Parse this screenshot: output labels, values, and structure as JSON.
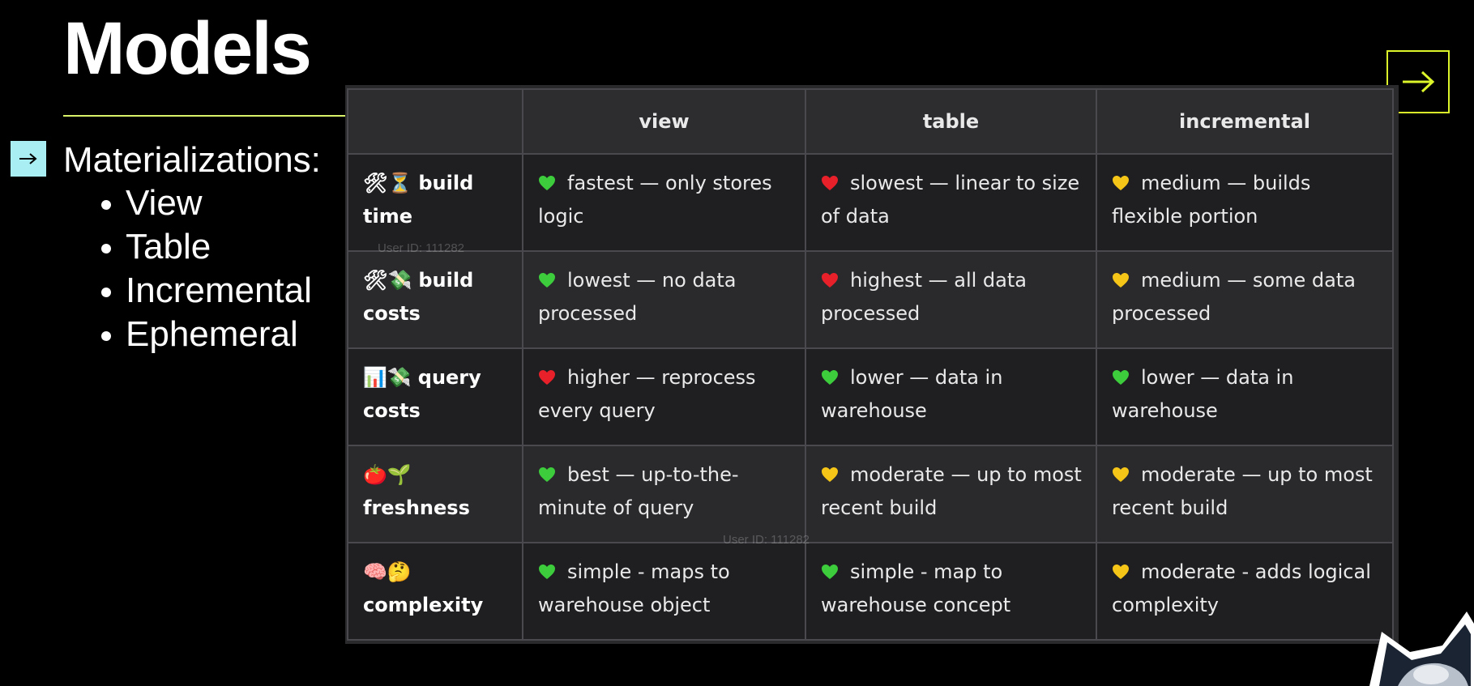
{
  "slide": {
    "title": "Models",
    "section_heading": "Materializations:",
    "bullets": [
      "View",
      "Table",
      "Incremental",
      "Ephemeral"
    ],
    "watermark_text": "User ID: 111282"
  },
  "table": {
    "columns": [
      "",
      "view",
      "table",
      "incremental"
    ],
    "rows": [
      {
        "label_emoji": "🛠⏳",
        "label": "build time",
        "cells": [
          {
            "rating": "green",
            "text": "fastest — only stores logic"
          },
          {
            "rating": "red",
            "text": "slowest — linear to size of data"
          },
          {
            "rating": "yellow",
            "text": "medium — builds flexible portion"
          }
        ]
      },
      {
        "label_emoji": "🛠💸",
        "label": "build costs",
        "cells": [
          {
            "rating": "green",
            "text": "lowest — no data processed"
          },
          {
            "rating": "red",
            "text": "highest — all data processed"
          },
          {
            "rating": "yellow",
            "text": "medium — some data processed"
          }
        ]
      },
      {
        "label_emoji": "📊💸",
        "label": "query costs",
        "cells": [
          {
            "rating": "red",
            "text": "higher — reprocess every query"
          },
          {
            "rating": "green",
            "text": "lower — data in warehouse"
          },
          {
            "rating": "green",
            "text": "lower — data in warehouse"
          }
        ]
      },
      {
        "label_emoji": "🍅🌱",
        "label": "freshness",
        "cells": [
          {
            "rating": "green",
            "text": "best — up-to-the-minute of query"
          },
          {
            "rating": "yellow",
            "text": "moderate — up to most recent build"
          },
          {
            "rating": "yellow",
            "text": "moderate — up to most recent build"
          }
        ]
      },
      {
        "label_emoji": "🧠🤔",
        "label": "complexity",
        "cells": [
          {
            "rating": "green",
            "text": "simple - maps to warehouse object"
          },
          {
            "rating": "green",
            "text": "simple - map to warehouse concept"
          },
          {
            "rating": "yellow",
            "text": "moderate - adds logical complexity"
          }
        ]
      }
    ]
  },
  "colors": {
    "accent_rule": "#d8f26a",
    "next_button_border": "#dcf52b",
    "bullet_arrow_bg": "#a8eef2",
    "heart_green": "#3ccc3c",
    "heart_red": "#e8202a",
    "heart_yellow": "#f5c518"
  },
  "icons": {
    "next": "arrow-right-icon",
    "bullet": "arrow-right-icon",
    "mascot": "husky-mascot-icon",
    "rating": "heart-icon"
  }
}
